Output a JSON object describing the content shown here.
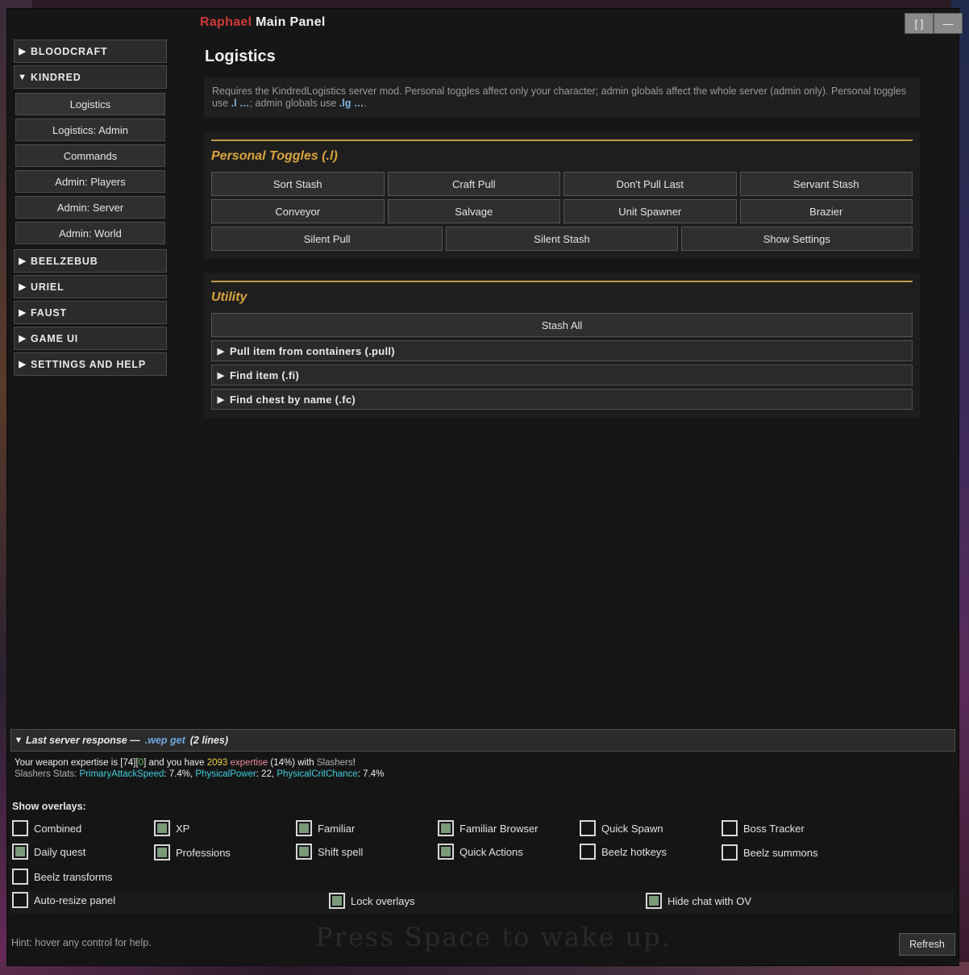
{
  "window": {
    "title_accent": "Raphael",
    "title_rest": "Main Panel",
    "maximize_label": "[ ]",
    "minimize_label": "—"
  },
  "sidebar": {
    "categories": [
      {
        "label": "BLOODCRAFT",
        "expanded": false
      },
      {
        "label": "KINDRED",
        "expanded": true,
        "items": [
          "Logistics",
          "Logistics: Admin",
          "Commands",
          "Admin: Players",
          "Admin: Server",
          "Admin: World"
        ]
      },
      {
        "label": "BEELZEBUB",
        "expanded": false
      },
      {
        "label": "URIEL",
        "expanded": false
      },
      {
        "label": "FAUST",
        "expanded": false
      },
      {
        "label": "GAME UI",
        "expanded": false
      },
      {
        "label": "SETTINGS AND HELP",
        "expanded": false
      }
    ]
  },
  "content": {
    "heading": "Logistics",
    "notice_text": "Requires the KindredLogistics server mod. Personal toggles affect only your character; admin globals affect the whole server (admin only). Personal toggles use ",
    "notice_cmd1": ".l …",
    "notice_mid": "; admin globals use ",
    "notice_cmd2": ".lg …",
    "notice_end": ".",
    "personal": {
      "title": "Personal Toggles (.l)",
      "row1": [
        "Sort Stash",
        "Craft Pull",
        "Don't Pull Last",
        "Servant Stash"
      ],
      "row2": [
        "Conveyor",
        "Salvage",
        "Unit Spawner",
        "Brazier"
      ],
      "row3": [
        "Silent Pull",
        "Silent Stash",
        "Show Settings"
      ]
    },
    "utility": {
      "title": "Utility",
      "stash_all": "Stash All",
      "collapsibles": [
        "Pull item from containers (.pull)",
        "Find item (.fi)",
        "Find chest by name (.fc)"
      ]
    }
  },
  "response": {
    "head_label": "Last server response —",
    "head_cmd": ".wep get",
    "head_lines": "(2 lines)",
    "l1_a": "Your weapon expertise is [74][",
    "l1_b": "0",
    "l1_c": "] and you have ",
    "l1_d": "2093",
    "l1_e": " expertise",
    "l1_f": " (14%) with ",
    "l1_g": "Slashers",
    "l1_h": "!",
    "l2_a": "Slashers Stats: ",
    "l2_b": "PrimaryAttackSpeed",
    "l2_c": ": 7.4%, ",
    "l2_d": "PhysicalPower",
    "l2_e": ": 22, ",
    "l2_f": "PhysicalCritChance",
    "l2_g": ": 7.4%"
  },
  "overlays": {
    "label": "Show overlays:",
    "items": [
      {
        "label": "Combined",
        "checked": false
      },
      {
        "label": "XP",
        "checked": true
      },
      {
        "label": "Familiar",
        "checked": true
      },
      {
        "label": "Familiar Browser",
        "checked": true
      },
      {
        "label": "Quick Spawn",
        "checked": false
      },
      {
        "label": "Boss Tracker",
        "checked": false
      },
      {
        "label": "Daily quest",
        "checked": true
      },
      {
        "label": "Professions",
        "checked": true
      },
      {
        "label": "Shift spell",
        "checked": true
      },
      {
        "label": "Quick Actions",
        "checked": true
      },
      {
        "label": "Beelz hotkeys",
        "checked": false
      },
      {
        "label": "Beelz summons",
        "checked": false
      },
      {
        "label": "Beelz transforms",
        "checked": false
      }
    ],
    "bottom": [
      {
        "label": "Auto-resize panel",
        "checked": false
      },
      {
        "label": "Lock overlays",
        "checked": true
      },
      {
        "label": "Hide chat with OV",
        "checked": true
      }
    ]
  },
  "footer": {
    "hint": "Hint: hover any control for help.",
    "wake_text": "Press Space to wake up.",
    "refresh_label": "Refresh"
  }
}
